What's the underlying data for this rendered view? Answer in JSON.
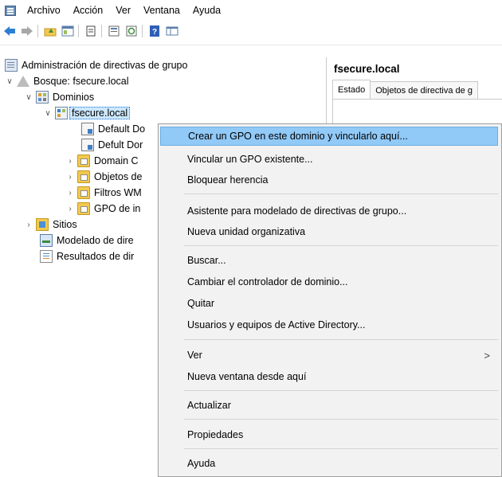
{
  "menubar": {
    "items": [
      "Archivo",
      "Acción",
      "Ver",
      "Ventana",
      "Ayuda"
    ]
  },
  "toolbar": {
    "icons": [
      "back-arrow-icon",
      "forward-arrow-icon",
      "folder-up-icon",
      "show-hide-tree-icon",
      "properties-icon",
      "help-icon"
    ]
  },
  "tree": {
    "root": "Administración de directivas de grupo",
    "forest": "Bosque: fsecure.local",
    "domains": "Dominios",
    "domain": "fsecure.local",
    "default_gpo1": "Default Do",
    "default_gpo2": "Defult Dor",
    "domain_controllers": "Domain C",
    "gpo_objects": "Objetos de",
    "wmi_filters": "Filtros WM",
    "starter_gpos": "GPO de in",
    "sites": "Sitios",
    "modeling": "Modelado de dire",
    "results": "Resultados de dir"
  },
  "right_pane": {
    "title": "fsecure.local",
    "tabs": [
      "Estado",
      "Objetos de directiva de g"
    ]
  },
  "context_menu": {
    "items": [
      "Crear un GPO en este dominio y vincularlo aquí...",
      "Vincular un GPO existente...",
      "Bloquear herencia",
      "Asistente para modelado de directivas de grupo...",
      "Nueva unidad organizativa",
      "Buscar...",
      "Cambiar el controlador de dominio...",
      "Quitar",
      "Usuarios y equipos de Active Directory...",
      "Ver",
      "Nueva ventana desde aquí",
      "Actualizar",
      "Propiedades",
      "Ayuda"
    ],
    "highlighted": "Crear un GPO en este dominio y vincularlo aquí...",
    "submenu_arrow": ">"
  },
  "colors": {
    "highlight": "#91c9f7",
    "selection": "#cce8ff",
    "menu_bg": "#f2f2f2"
  }
}
